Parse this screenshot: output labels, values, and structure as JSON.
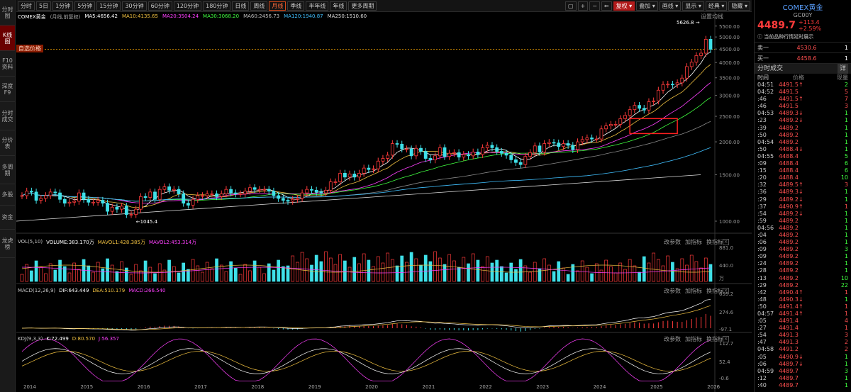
{
  "sidebar": [
    {
      "label": "分时图",
      "active": false
    },
    {
      "label": "K线图",
      "active": true
    },
    {
      "label": "F10资料",
      "active": false
    },
    {
      "label": "深度F9",
      "active": false
    },
    {
      "label": "分时成交",
      "active": false
    },
    {
      "label": "分价表",
      "active": false
    },
    {
      "label": "多周期",
      "active": false
    },
    {
      "label": "多股",
      "active": false
    },
    {
      "label": "资金",
      "active": false
    },
    {
      "label": "龙虎榜",
      "active": false
    }
  ],
  "toolbar": {
    "periods": [
      "分时",
      "5日",
      "1分钟",
      "5分钟",
      "15分钟",
      "30分钟",
      "60分钟",
      "120分钟",
      "180分钟",
      "日线",
      "周线",
      "月线",
      "季线",
      "半年线",
      "年线",
      "更多周期"
    ],
    "active_period": "月线",
    "right": [
      "复权",
      "叠加",
      "画线",
      "显示",
      "经典",
      "隐藏"
    ],
    "right_icons": [
      "▢",
      "+",
      "−",
      "⇐"
    ]
  },
  "main": {
    "title": "COMEX黄金",
    "subtitle": "(月线,前复权)",
    "ma": [
      {
        "label": "MA5:4656.42",
        "color": "#ffffff"
      },
      {
        "label": "MA10:4135.65",
        "color": "#f0c040"
      },
      {
        "label": "MA20:3504.24",
        "color": "#ff40ff"
      },
      {
        "label": "MA30:3068.20",
        "color": "#40ff40"
      },
      {
        "label": "MA60:2456.73",
        "color": "#c0c0c0"
      },
      {
        "label": "MA120:1940.87",
        "color": "#40c0ff"
      },
      {
        "label": "MA250:1510.60",
        "color": "#dddddd"
      }
    ],
    "setting": "设置均线",
    "price_tag": "自选价格",
    "high_label": "5626.8",
    "low_label": "1045.4",
    "y_ticks": [
      "5500.00",
      "5000.00",
      "4500.00",
      "4000.00",
      "3500.00",
      "3000.00",
      "2500.00",
      "2000.00",
      "1500.00",
      "1000.00"
    ],
    "x_ticks": [
      "2014",
      "2015",
      "2016",
      "2017",
      "2018",
      "2019",
      "2020",
      "2021",
      "2022",
      "2023",
      "2024",
      "2025",
      "2026"
    ]
  },
  "vol_pane": {
    "name": "VOL(5,10)",
    "v1": "VOLUME:383.170万",
    "v2": "MAVOL1:428.385万",
    "v3": "MAVOL2:453.314万",
    "ticks": [
      "881.0",
      "440.0",
      "万"
    ],
    "tools": [
      "改参数",
      "加指标",
      "换指标"
    ]
  },
  "macd_pane": {
    "name": "MACD(12,26,9)",
    "v1": "DIF:643.449",
    "v2": "DEA:510.179",
    "v3": "MACD:266.540",
    "ticks": [
      "655.2",
      "274.6",
      "-97.1"
    ],
    "tools": [
      "改参数",
      "加指标",
      "换指标"
    ]
  },
  "kdj_pane": {
    "name": "KDJ(9,3,3)",
    "v1": "K:72.499",
    "v2": "D:80.570",
    "v3": "J:56.357",
    "ticks": [
      "112.7",
      "52.4",
      "-0.6"
    ],
    "tools": [
      "改参数",
      "加指标",
      "换指标"
    ]
  },
  "right_panel": {
    "name": "COMEX黄金",
    "code": "GC00Y",
    "price": "4489.7",
    "change": "+113.4",
    "pct": "+2.59%",
    "notice": "当前品种行情延时展示",
    "sell1_label": "卖一",
    "sell1_price": "4530.6",
    "sell1_vol": "1",
    "buy1_label": "买一",
    "buy1_price": "4458.6",
    "buy1_vol": "1",
    "trades_title": "分时成交",
    "trades_btn": "详",
    "col_time": "时间",
    "col_price": "价格",
    "col_vol": "现量",
    "trades": [
      {
        "t": "04:51",
        "p": "4491.5↑",
        "v": "2",
        "c": "#40ff40"
      },
      {
        "t": "04:52",
        "p": "4491.5",
        "v": "5",
        "c": "#ff5050"
      },
      {
        "t": ":46",
        "p": "4491.5↑",
        "v": "7",
        "c": "#ff5050"
      },
      {
        "t": ":46",
        "p": "4491.5",
        "v": "3",
        "c": "#ff5050"
      },
      {
        "t": "04:53",
        "p": "4489.3↓",
        "v": "1",
        "c": "#40ff40"
      },
      {
        "t": ":23",
        "p": "4489.2↓",
        "v": "1",
        "c": "#40ff40"
      },
      {
        "t": ":39",
        "p": "4489.2",
        "v": "1",
        "c": "#40ff40"
      },
      {
        "t": ":50",
        "p": "4489.2",
        "v": "1",
        "c": "#40ff40"
      },
      {
        "t": "04:54",
        "p": "4489.2",
        "v": "1",
        "c": "#40ff40"
      },
      {
        "t": ":50",
        "p": "4488.4↓",
        "v": "1",
        "c": "#40ff40"
      },
      {
        "t": "04:55",
        "p": "4488.4",
        "v": "5",
        "c": "#40ff40"
      },
      {
        "t": ":09",
        "p": "4488.4",
        "v": "6",
        "c": "#40ff40"
      },
      {
        "t": ":15",
        "p": "4488.4",
        "v": "6",
        "c": "#40ff40"
      },
      {
        "t": ":20",
        "p": "4488.4",
        "v": "10",
        "c": "#40ff40"
      },
      {
        "t": ":32",
        "p": "4489.5↑",
        "v": "3",
        "c": "#ff5050"
      },
      {
        "t": ":36",
        "p": "4489.3↓",
        "v": "1",
        "c": "#40ff40"
      },
      {
        "t": ":29",
        "p": "4489.2↓",
        "v": "1",
        "c": "#40ff40"
      },
      {
        "t": ":37",
        "p": "4490.9↑",
        "v": "1",
        "c": "#ff5050"
      },
      {
        "t": ":54",
        "p": "4489.2↓",
        "v": "1",
        "c": "#40ff40"
      },
      {
        "t": ":59",
        "p": "4489.2",
        "v": "1",
        "c": "#40ff40"
      },
      {
        "t": "04:56",
        "p": "4489.2",
        "v": "1",
        "c": "#40ff40"
      },
      {
        "t": ":04",
        "p": "4489.2",
        "v": "1",
        "c": "#40ff40"
      },
      {
        "t": ":06",
        "p": "4489.2",
        "v": "1",
        "c": "#40ff40"
      },
      {
        "t": ":09",
        "p": "4489.2",
        "v": "3",
        "c": "#40ff40"
      },
      {
        "t": ":09",
        "p": "4489.2",
        "v": "1",
        "c": "#40ff40"
      },
      {
        "t": ":24",
        "p": "4489.2",
        "v": "1",
        "c": "#40ff40"
      },
      {
        "t": ":28",
        "p": "4489.2",
        "v": "1",
        "c": "#40ff40"
      },
      {
        "t": ":13",
        "p": "4489.2",
        "v": "10",
        "c": "#40ff40"
      },
      {
        "t": ":29",
        "p": "4489.2",
        "v": "22",
        "c": "#40ff40"
      },
      {
        "t": ":42",
        "p": "4490.4↑",
        "v": "1",
        "c": "#ff5050"
      },
      {
        "t": ":48",
        "p": "4490.3↓",
        "v": "1",
        "c": "#40ff40"
      },
      {
        "t": ":50",
        "p": "4491.4↑",
        "v": "1",
        "c": "#ff5050"
      },
      {
        "t": "04:57",
        "p": "4491.4↑",
        "v": "1",
        "c": "#ff5050"
      },
      {
        "t": ":05",
        "p": "4491.4",
        "v": "4",
        "c": "#ff5050"
      },
      {
        "t": ":27",
        "p": "4491.4",
        "v": "1",
        "c": "#ff5050"
      },
      {
        "t": ":54",
        "p": "4491.3",
        "v": "3",
        "c": "#ff5050"
      },
      {
        "t": ":47",
        "p": "4491.3",
        "v": "2",
        "c": "#ff5050"
      },
      {
        "t": "04:58",
        "p": "4491.2",
        "v": "2",
        "c": "#ff5050"
      },
      {
        "t": ":05",
        "p": "4490.9↓",
        "v": "1",
        "c": "#40ff40"
      },
      {
        "t": ":06",
        "p": "4489.7↓",
        "v": "1",
        "c": "#40ff40"
      },
      {
        "t": "04:59",
        "p": "4489.7",
        "v": "3",
        "c": "#40ff40"
      },
      {
        "t": ":12",
        "p": "4489.7",
        "v": "1",
        "c": "#40ff40"
      },
      {
        "t": ":40",
        "p": "4489.7",
        "v": "1",
        "c": "#40ff40"
      }
    ]
  },
  "chart_data": {
    "type": "candlestick",
    "title": "COMEX黄金 (月线,前复权)",
    "x_range": [
      "2014",
      "2026"
    ],
    "ylim": [
      900,
      5700
    ],
    "series_close_approx": [
      1250,
      1300,
      1290,
      1200,
      1220,
      1250,
      1290,
      1280,
      1210,
      1170,
      1180,
      1190,
      1280,
      1210,
      1180,
      1180,
      1200,
      1170,
      1090,
      1130,
      1110,
      1140,
      1060,
      1060,
      1110,
      1240,
      1230,
      1290,
      1210,
      1320,
      1350,
      1310,
      1320,
      1270,
      1170,
      1150,
      1210,
      1250,
      1250,
      1270,
      1270,
      1240,
      1270,
      1320,
      1280,
      1270,
      1270,
      1300,
      1340,
      1320,
      1320,
      1320,
      1300,
      1250,
      1220,
      1200,
      1190,
      1210,
      1220,
      1280,
      1320,
      1310,
      1290,
      1280,
      1310,
      1410,
      1410,
      1520,
      1470,
      1510,
      1470,
      1520,
      1590,
      1570,
      1580,
      1690,
      1730,
      1780,
      1970,
      1960,
      1880,
      1880,
      1770,
      1890,
      1840,
      1730,
      1710,
      1770,
      1900,
      1760,
      1810,
      1820,
      1750,
      1790,
      1770,
      1830,
      1790,
      1900,
      1940,
      1900,
      1840,
      1810,
      1780,
      1710,
      1670,
      1640,
      1760,
      1820,
      1930,
      1830,
      1970,
      1990,
      1980,
      1920,
      1970,
      1940,
      1870,
      2000,
      2040,
      2070,
      2050,
      2050,
      2240,
      2300,
      2330,
      2330,
      2450,
      2520,
      2650,
      2750,
      2680,
      2640,
      2840,
      2860,
      3140,
      3300,
      3310,
      3300,
      3350,
      3490,
      3860,
      4010,
      4250,
      4340,
      4900,
      4489
    ]
  }
}
